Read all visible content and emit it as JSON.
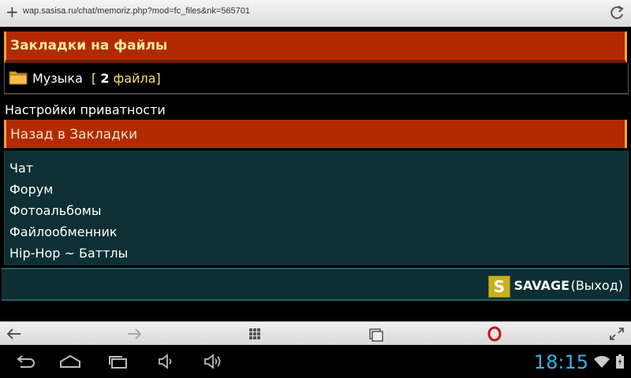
{
  "browser": {
    "url": "wap.sasisa.ru/chat/memoriz.php?mod=fc_files&nk=565701"
  },
  "bookmarks": {
    "title": "Закладки на файлы",
    "folder": {
      "name": "Музыка",
      "count_prefix": "[",
      "count_num": "2",
      "count_suffix": "файла]"
    }
  },
  "privacy_link": "Настройки приватности",
  "back_link": "Назад в Закладки",
  "nav_links": [
    "Чат",
    "Форум",
    "Фотоальбомы",
    "Файлообменник",
    "Hip-Hop  ~ Баттлы"
  ],
  "user": {
    "logo_letter": "S",
    "name": "SAVAGE",
    "exit": "(Выход)"
  },
  "system": {
    "clock": "18:15"
  },
  "colors": {
    "header_red": "#b12a02",
    "panel_teal": "#0e3034",
    "clock_blue": "#33b5e5"
  }
}
